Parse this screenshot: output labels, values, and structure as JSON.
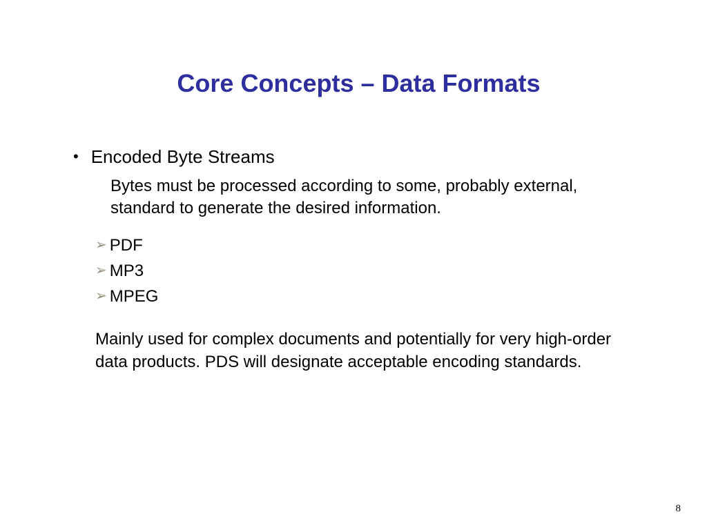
{
  "title": "Core Concepts – Data Formats",
  "bullet": {
    "heading": "Encoded Byte Streams",
    "description": "Bytes must be processed according to some, probably external, standard to generate the desired information."
  },
  "examples": [
    "PDF",
    "MP3",
    "MPEG"
  ],
  "footer_text": "Mainly used for complex documents and potentially for very high-order data products.  PDS will designate acceptable encoding standards.",
  "page_number": "8"
}
